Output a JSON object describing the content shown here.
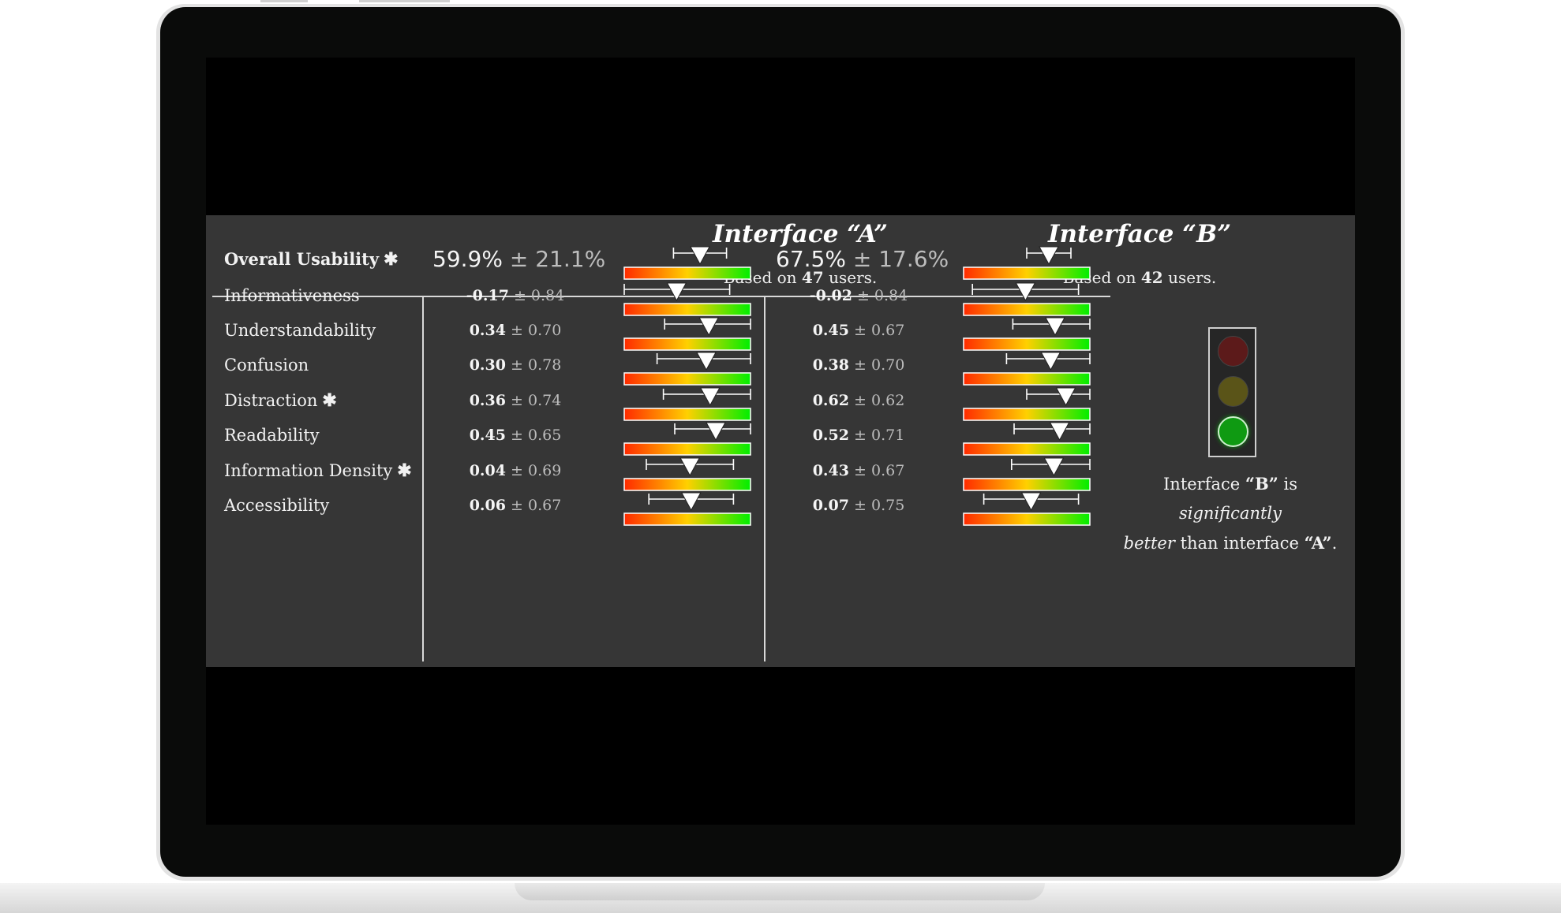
{
  "interfaces": [
    {
      "title": "Interface “A”",
      "based_prefix": "Based on ",
      "user_count": "47",
      "users_suffix": " users."
    },
    {
      "title": "Interface “B”",
      "based_prefix": "Based on ",
      "user_count": "42",
      "users_suffix": " users."
    }
  ],
  "metrics": [
    {
      "label": "Overall Usability",
      "star": "✱",
      "bold": true,
      "a": {
        "mean": "59.9%",
        "err": "± 21.1%",
        "marker": 0.6,
        "lo": 0.39,
        "hi": 0.81
      },
      "b": {
        "mean": "67.5%",
        "err": "± 17.6%",
        "marker": 0.675,
        "lo": 0.5,
        "hi": 0.85
      }
    },
    {
      "label": "Informativeness",
      "star": "",
      "a": {
        "mean": "-0.17",
        "err": "± 0.84",
        "marker": 0.415,
        "lo": 0.0,
        "hi": 0.835
      },
      "b": {
        "mean": "-0.02",
        "err": "± 0.84",
        "marker": 0.49,
        "lo": 0.07,
        "hi": 0.91
      }
    },
    {
      "label": "Understandability",
      "star": "",
      "a": {
        "mean": "0.34",
        "err": "± 0.70",
        "marker": 0.67,
        "lo": 0.32,
        "hi": 1.0
      },
      "b": {
        "mean": "0.45",
        "err": "± 0.67",
        "marker": 0.725,
        "lo": 0.39,
        "hi": 1.0
      }
    },
    {
      "label": "Confusion",
      "star": "",
      "a": {
        "mean": "0.30",
        "err": "± 0.78",
        "marker": 0.65,
        "lo": 0.26,
        "hi": 1.0
      },
      "b": {
        "mean": "0.38",
        "err": "± 0.70",
        "marker": 0.69,
        "lo": 0.34,
        "hi": 1.0
      }
    },
    {
      "label": "Distraction",
      "star": "✱",
      "a": {
        "mean": "0.36",
        "err": "± 0.74",
        "marker": 0.68,
        "lo": 0.31,
        "hi": 1.0
      },
      "b": {
        "mean": "0.62",
        "err": "± 0.62",
        "marker": 0.81,
        "lo": 0.5,
        "hi": 1.0
      }
    },
    {
      "label": "Readability",
      "star": "",
      "a": {
        "mean": "0.45",
        "err": "± 0.65",
        "marker": 0.725,
        "lo": 0.4,
        "hi": 1.0
      },
      "b": {
        "mean": "0.52",
        "err": "± 0.71",
        "marker": 0.76,
        "lo": 0.4,
        "hi": 1.0
      }
    },
    {
      "label": "Information Density",
      "star": "✱",
      "a": {
        "mean": "0.04",
        "err": "± 0.69",
        "marker": 0.52,
        "lo": 0.175,
        "hi": 0.865
      },
      "b": {
        "mean": "0.43",
        "err": "± 0.67",
        "marker": 0.715,
        "lo": 0.38,
        "hi": 1.0
      }
    },
    {
      "label": "Accessibility",
      "star": "",
      "a": {
        "mean": "0.06",
        "err": "± 0.67",
        "marker": 0.53,
        "lo": 0.195,
        "hi": 0.865
      },
      "b": {
        "mean": "0.07",
        "err": "± 0.75",
        "marker": 0.535,
        "lo": 0.16,
        "hi": 0.91
      }
    }
  ],
  "traffic_light": {
    "active": "green",
    "red": "#5c1a1a",
    "yellow": "#5a5418",
    "green": "#0f9a12"
  },
  "verdict": {
    "p1": "Interface ",
    "b1": "“B”",
    "p2": " is ",
    "i1": "significantly",
    "i2": "better",
    "p3": " than interface ",
    "b2": "“A”",
    "p4": "."
  },
  "colors": {
    "panel": "#363636",
    "gradient": [
      "#ff2a00",
      "#ffd000",
      "#00ee00"
    ]
  }
}
